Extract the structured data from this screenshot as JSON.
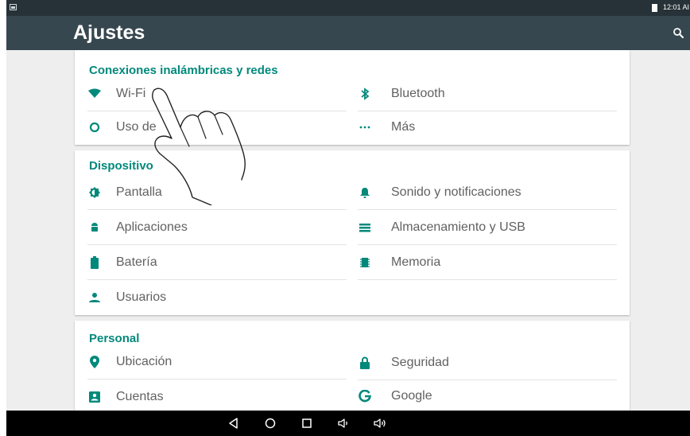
{
  "status_bar": {
    "time": "12:01 AI",
    "notification_icon": "image-icon",
    "battery_icon": "battery-icon"
  },
  "app_bar": {
    "title": "Ajustes",
    "search_icon": "search-icon"
  },
  "colors": {
    "accent": "#00897b",
    "app_bar": "#37474f",
    "status_bar": "#263238",
    "background": "#eeeeee",
    "text": "#616161",
    "nav_bar": "#000000"
  },
  "sections": [
    {
      "title": "Conexiones inalámbricas y redes",
      "items": [
        {
          "label": "Wi-Fi",
          "icon": "wifi-icon"
        },
        {
          "label": "Bluetooth",
          "icon": "bluetooth-icon"
        },
        {
          "label": "Uso de",
          "icon": "data-usage-icon"
        },
        {
          "label": "Más",
          "icon": "more-icon"
        }
      ]
    },
    {
      "title": "Dispositivo",
      "items": [
        {
          "label": "Pantalla",
          "icon": "brightness-icon"
        },
        {
          "label": "Sonido y notificaciones",
          "icon": "bell-icon"
        },
        {
          "label": "Aplicaciones",
          "icon": "android-icon"
        },
        {
          "label": "Almacenamiento y USB",
          "icon": "storage-icon"
        },
        {
          "label": "Batería",
          "icon": "battery-icon"
        },
        {
          "label": "Memoria",
          "icon": "memory-icon"
        },
        {
          "label": "Usuarios",
          "icon": "person-icon"
        }
      ]
    },
    {
      "title": "Personal",
      "items": [
        {
          "label": "Ubicación",
          "icon": "location-icon"
        },
        {
          "label": "Seguridad",
          "icon": "lock-icon"
        },
        {
          "label": "Cuentas",
          "icon": "account-icon"
        },
        {
          "label": "Google",
          "icon": "google-icon"
        }
      ]
    }
  ],
  "nav_bar": {
    "buttons": [
      "back-icon",
      "home-icon",
      "recents-icon",
      "volume-down-icon",
      "volume-up-icon"
    ]
  },
  "overlay": {
    "icon": "hand-pointer-icon"
  }
}
